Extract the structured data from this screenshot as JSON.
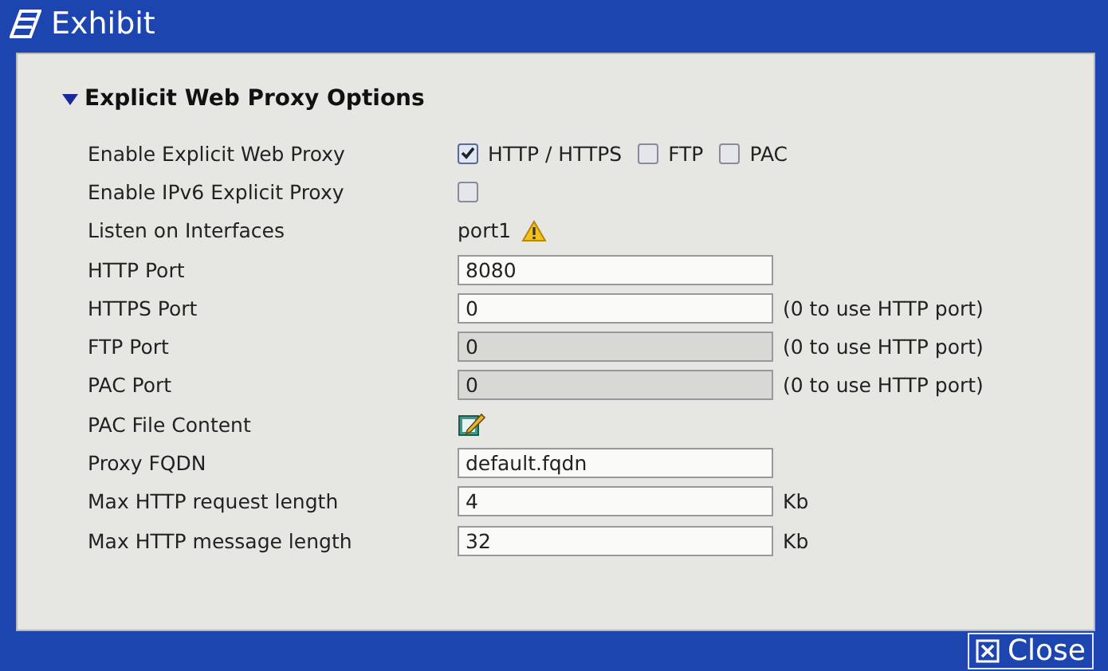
{
  "window": {
    "title": "Exhibit"
  },
  "section": {
    "title": "Explicit Web Proxy Options",
    "expanded": true
  },
  "rows": [
    {
      "kind": "checkboxes",
      "label": "Enable Explicit Web Proxy",
      "options": [
        {
          "label": "HTTP / HTTPS",
          "checked": true
        },
        {
          "label": "FTP",
          "checked": false
        },
        {
          "label": "PAC",
          "checked": false
        }
      ]
    },
    {
      "kind": "checkboxes",
      "label": "Enable IPv6 Explicit Proxy",
      "options": [
        {
          "checked": false
        }
      ]
    },
    {
      "kind": "interface",
      "label": "Listen on Interfaces",
      "value": "port1"
    },
    {
      "kind": "input",
      "label": "HTTP Port",
      "value": "8080",
      "disabled": false
    },
    {
      "kind": "input",
      "label": "HTTPS Port",
      "value": "0",
      "disabled": false,
      "note": "(0 to use HTTP port)"
    },
    {
      "kind": "input",
      "label": "FTP Port",
      "value": "0",
      "disabled": true,
      "note": "(0 to use HTTP port)"
    },
    {
      "kind": "input",
      "label": "PAC Port",
      "value": "0",
      "disabled": true,
      "note": "(0 to use HTTP port)"
    },
    {
      "kind": "edit",
      "label": "PAC File Content"
    },
    {
      "kind": "input",
      "label": "Proxy FQDN",
      "value": "default.fqdn",
      "disabled": false
    },
    {
      "kind": "input",
      "label": "Max HTTP request length",
      "value": "4",
      "disabled": false,
      "note": "Kb"
    },
    {
      "kind": "input",
      "label": "Max HTTP message length",
      "value": "32",
      "disabled": false,
      "note": "Kb"
    }
  ],
  "buttons": [
    {
      "label": "Close"
    }
  ]
}
